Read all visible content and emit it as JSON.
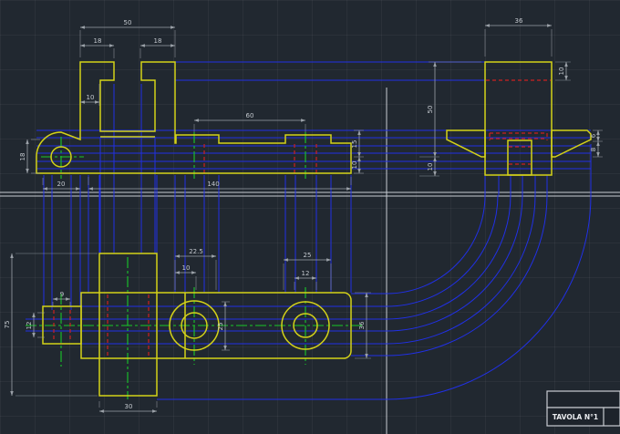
{
  "drawing": {
    "title_block": {
      "sheet_label": "TAVOLA N°1"
    },
    "views": {
      "front": {
        "overall_width": "50",
        "left_tab": "18",
        "right_tab": "18",
        "step": "10",
        "pad_span": "60",
        "total_length": "140",
        "boss_offset": "20",
        "boss_height": "18",
        "mid_height_upper": "15",
        "mid_height_lower": "10",
        "side_height_upper": "50",
        "side_height_lower": "10"
      },
      "side": {
        "width": "36",
        "top_step": "10",
        "wing_upper": "6",
        "wing_lower": "8"
      },
      "plan": {
        "left_pad": "22.5",
        "left_slot": "10",
        "right_pad": "25",
        "right_hole": "12",
        "tab_slot": "9",
        "tab_bore": "12",
        "overall_depth": "75",
        "left_bore": "25",
        "bar_depth": "36",
        "bottom_pad": "30"
      }
    }
  },
  "colors": {
    "object": "#d4d219",
    "projection": "#2130e6",
    "hidden": "#cc2020",
    "center": "#19c929",
    "dim": "#9ba1a8",
    "dimtext": "#c3c8ce",
    "construction": "#c8ccd2",
    "title-border": "#c8ccd2",
    "title-text": "#e9ebee"
  }
}
